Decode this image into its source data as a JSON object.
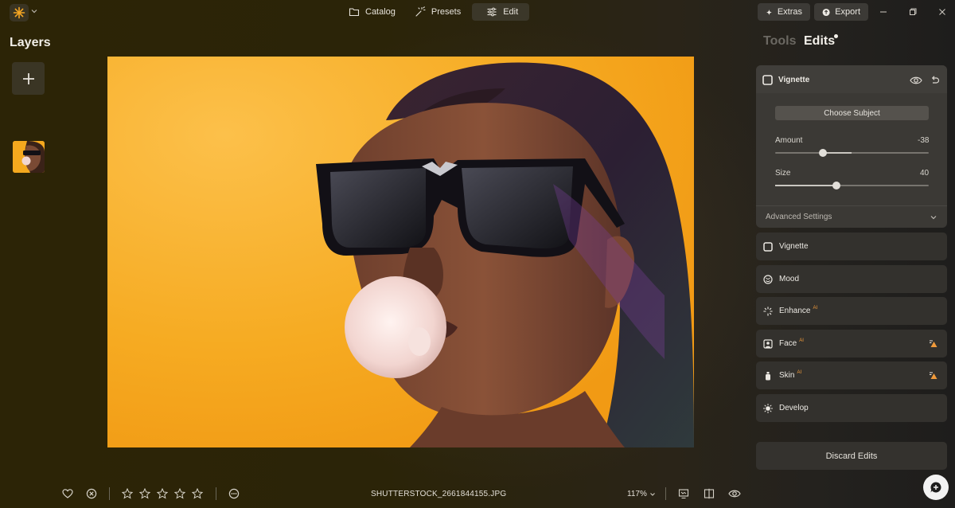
{
  "topbar": {
    "logo_icon": "sun-logo-icon",
    "tabs": [
      {
        "label": "Catalog",
        "icon": "folder-icon"
      },
      {
        "label": "Presets",
        "icon": "sparkle-wand-icon"
      },
      {
        "label": "Edit",
        "icon": "sliders-icon",
        "active": true
      }
    ],
    "extras_label": "Extras",
    "export_label": "Export"
  },
  "layers": {
    "title": "Layers",
    "add_icon": "plus-icon"
  },
  "panel": {
    "tabs": [
      {
        "label": "Tools",
        "active": false
      },
      {
        "label": "Edits",
        "active": true
      }
    ],
    "vignette": {
      "title": "Vignette",
      "choose_subject": "Choose Subject",
      "amount": {
        "label": "Amount",
        "value": "-38",
        "level": 0.31
      },
      "size": {
        "label": "Size",
        "value": "40",
        "level": 0.4
      },
      "advanced_label": "Advanced Settings"
    },
    "tools": [
      {
        "label": "Vignette",
        "icon": "square-icon",
        "ai": false
      },
      {
        "label": "Mood",
        "icon": "mood-icon",
        "ai": false
      },
      {
        "label": "Enhance",
        "icon": "enhance-icon",
        "ai": true
      },
      {
        "label": "Face",
        "icon": "face-icon",
        "ai": true,
        "warning": true
      },
      {
        "label": "Skin",
        "icon": "skin-icon",
        "ai": true,
        "warning": true
      },
      {
        "label": "Develop",
        "icon": "sun-icon",
        "ai": false
      }
    ],
    "ai_mark": "AI",
    "discard_label": "Discard Edits"
  },
  "bottombar": {
    "filename": "SHUTTERSTOCK_2661844155.JPG",
    "zoom": "117%",
    "rating": 0,
    "max_rating": 5
  },
  "colors": {
    "accent_ai": "#f09a3b",
    "photo_bg": "#f5a91f"
  }
}
